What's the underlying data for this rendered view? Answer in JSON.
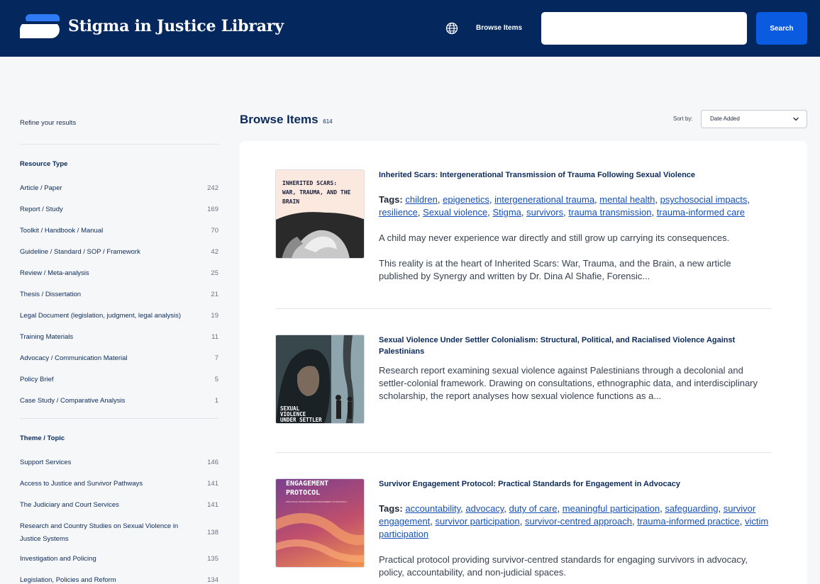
{
  "header": {
    "site_title": "Stigma in Justice Library",
    "nav_browse": "Browse Items",
    "search_placeholder": "",
    "search_button": "Search",
    "brand_color": "#04275e",
    "accent_color": "#0a5be0",
    "globe_icon": "globe-icon"
  },
  "sidebar": {
    "refine_label": "Refine your results",
    "facets": [
      {
        "title": "Resource Type",
        "items": [
          {
            "label": "Article / Paper",
            "count": "242"
          },
          {
            "label": "Report / Study",
            "count": "169"
          },
          {
            "label": "Toolkit / Handbook / Manual",
            "count": "70"
          },
          {
            "label": "Guideline / Standard / SOP / Framework",
            "count": "42"
          },
          {
            "label": "Review / Meta-analysis",
            "count": "25"
          },
          {
            "label": "Thesis / Dissertation",
            "count": "21"
          },
          {
            "label": "Legal Document (legislation, judgment, legal analysis)",
            "count": "19"
          },
          {
            "label": "Training Materials",
            "count": "11"
          },
          {
            "label": "Advocacy / Communication Material",
            "count": "7"
          },
          {
            "label": "Policy Brief",
            "count": "5"
          },
          {
            "label": "Case Study / Comparative Analysis",
            "count": "1"
          }
        ]
      },
      {
        "title": "Theme / Topic",
        "items": [
          {
            "label": "Support Services",
            "count": "146"
          },
          {
            "label": "Access to Justice and Survivor Pathways",
            "count": "141"
          },
          {
            "label": "The Judiciary and Court Services",
            "count": "141"
          },
          {
            "label": "Research and Country Studies on Sexual Violence in Justice Systems",
            "count": "138"
          },
          {
            "label": "Investigation and Policing",
            "count": "135"
          },
          {
            "label": "Legislation, Policies and Reform",
            "count": "134"
          }
        ]
      }
    ]
  },
  "main": {
    "title": "Browse Items",
    "count": "614",
    "sort_label": "Sort by:",
    "sort_value": "Date Added",
    "items": [
      {
        "title": "Inherited Scars: Intergenerational Transmission of Trauma Following Sexual Violence",
        "tags_label": "Tags:",
        "tags": [
          "children",
          "epigenetics",
          "intergenerational trauma",
          "mental health",
          "psychosocial impacts",
          "resilience",
          "Sexual violence",
          "Stigma",
          "survivors",
          "trauma transmission",
          "trauma-informed care"
        ],
        "desc": [
          "A child may never experience war directly and still grow up carrying its consequences.",
          "This reality is at the heart of Inherited Scars: War, Trauma, and the Brain, a new article published by Synergy and written by Dr. Dina Al Shafie, Forensic..."
        ],
        "thumb_text": [
          "INHERITED SCARS:",
          "WAR, TRAUMA, AND THE BRAIN"
        ]
      },
      {
        "title": "Sexual Violence Under Settler Colonialism: Structural, Political, and Racialised Violence Against Palestinians",
        "tags_label": "",
        "tags": [],
        "desc": [
          "Research report examining sexual violence against Palestinians through a decolonial and settler-colonial framework. Drawing on consultations, ethnographic data, and interdisciplinary scholarship, the report analyses how sexual violence functions as a..."
        ],
        "thumb_text": [
          "SEXUAL",
          "VIOLENCE",
          "UNDER SETTLER"
        ]
      },
      {
        "title": "Survivor Engagement Protocol: Practical Standards for Engagement in Advocacy",
        "tags_label": "Tags:",
        "tags": [
          "accountability",
          "advocacy",
          "duty of care",
          "meaningful participation",
          "safeguarding",
          "survivor engagement",
          "survivor participation",
          "survivor-centred approach",
          "trauma-informed practice",
          "victim participation"
        ],
        "desc": [
          "Practical protocol providing survivor-centred standards for engaging survivors in advocacy, policy, accountability, and non-judicial spaces."
        ],
        "thumb_text": [
          "ENGAGEMENT",
          "PROTOCOL",
          "PRACTICAL STANDARDS FOR ENGAGEMENT IN ADVOCACY"
        ]
      }
    ]
  }
}
